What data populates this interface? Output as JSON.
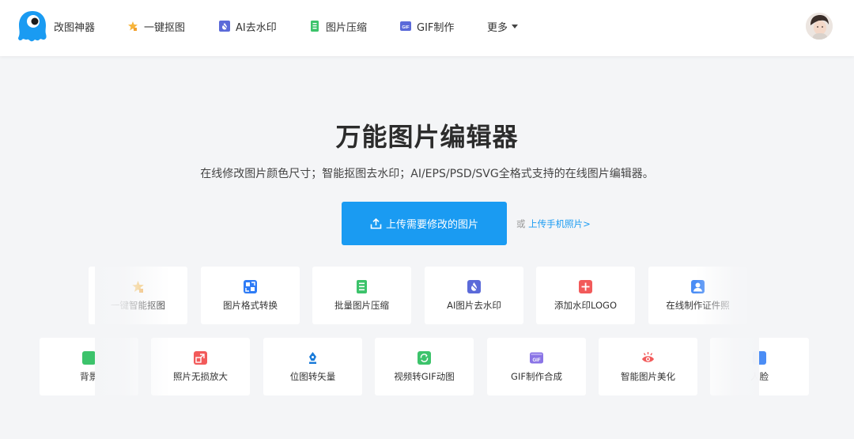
{
  "header": {
    "brand": "改图神器",
    "nav": [
      {
        "label": "一键抠图",
        "icon": "star-cut-icon"
      },
      {
        "label": "AI去水印",
        "icon": "water-drop-icon"
      },
      {
        "label": "图片压缩",
        "icon": "compress-icon"
      },
      {
        "label": "GIF制作",
        "icon": "gif-icon"
      }
    ],
    "more": "更多"
  },
  "hero": {
    "title": "万能图片编辑器",
    "subtitle": "在线修改图片颜色尺寸；智能抠图去水印；AI/EPS/PSD/SVG全格式支持的在线图片编辑器。",
    "upload_button": "上传需要修改的图片",
    "alt_prefix": "或",
    "alt_link": "上传手机照片>"
  },
  "tools_row1": [
    {
      "label": "一键智能抠图",
      "icon": "star-cut-icon"
    },
    {
      "label": "图片格式转换",
      "icon": "format-convert-icon"
    },
    {
      "label": "批量图片压缩",
      "icon": "compress-icon"
    },
    {
      "label": "AI图片去水印",
      "icon": "water-drop-icon"
    },
    {
      "label": "添加水印LOGO",
      "icon": "plus-icon"
    },
    {
      "label": "在线制作证件照",
      "icon": "id-photo-icon"
    }
  ],
  "tools_row2": [
    {
      "label": "背景",
      "icon": "background-icon"
    },
    {
      "label": "照片无损放大",
      "icon": "enlarge-icon"
    },
    {
      "label": "位图转矢量",
      "icon": "vector-pen-icon"
    },
    {
      "label": "视频转GIF动图",
      "icon": "video-gif-icon"
    },
    {
      "label": "GIF制作合成",
      "icon": "gif-icon"
    },
    {
      "label": "智能图片美化",
      "icon": "beautify-eye-icon"
    },
    {
      "label": "人脸",
      "icon": "face-icon"
    }
  ],
  "colors": {
    "accent": "#1a9bf2",
    "background": "#f4f5f7",
    "star": "#f7b53b",
    "indigo": "#5b6ad9",
    "green": "#3cc36b",
    "red": "#f25a5a",
    "purple": "#8a74e6",
    "sky": "#4b8df5"
  }
}
